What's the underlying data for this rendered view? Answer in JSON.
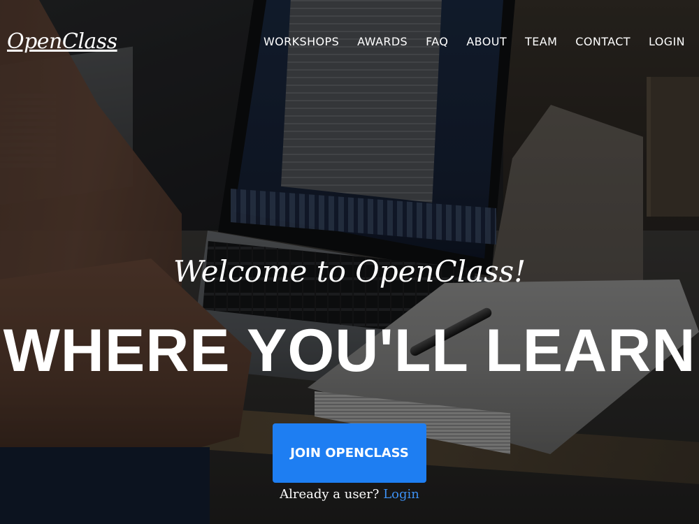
{
  "brand": {
    "logo_text": "OpenClass"
  },
  "nav": {
    "items": [
      {
        "label": "WORKSHOPS"
      },
      {
        "label": "AWARDS"
      },
      {
        "label": "FAQ"
      },
      {
        "label": "ABOUT"
      },
      {
        "label": "TEAM"
      },
      {
        "label": "CONTACT"
      },
      {
        "label": "LOGIN"
      }
    ]
  },
  "hero": {
    "welcome": "Welcome to OpenClass!",
    "headline": "WHERE YOU'LL LEARN",
    "cta_label": "JOIN OPENCLASS",
    "existing_user_text": "Already a user?",
    "login_link": "Login"
  },
  "colors": {
    "accent": "#1e7ef2",
    "link": "#3d8ff0",
    "text": "#ffffff"
  }
}
